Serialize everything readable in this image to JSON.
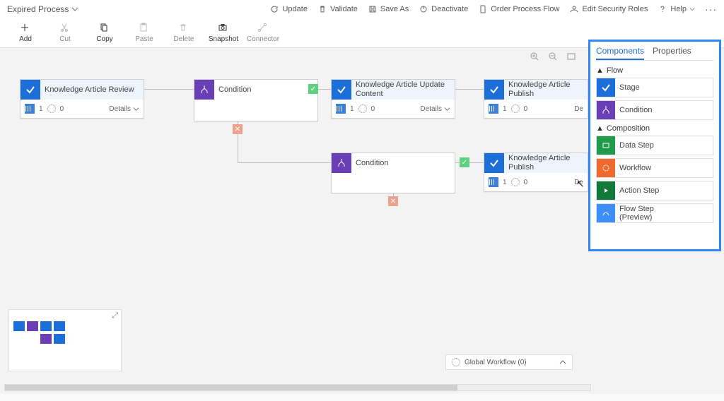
{
  "header": {
    "title": "Expired Process",
    "actions": [
      "Update",
      "Validate",
      "Save As",
      "Deactivate",
      "Order Process Flow",
      "Edit Security Roles",
      "Help"
    ]
  },
  "ribbon": {
    "items": [
      "Add",
      "Cut",
      "Copy",
      "Paste",
      "Delete",
      "Snapshot",
      "Connector"
    ]
  },
  "nodes": {
    "stage1": {
      "title": "Knowledge Article Review",
      "count": "1",
      "sub": "0",
      "details": "Details"
    },
    "cond1": {
      "title": "Condition"
    },
    "stage2": {
      "title": "Knowledge Article Update Content",
      "count": "1",
      "sub": "0",
      "details": "Details"
    },
    "stage3": {
      "title": "Knowledge Article Publish",
      "count": "1",
      "sub": "0",
      "details": "De"
    },
    "cond2": {
      "title": "Condition"
    },
    "stage4": {
      "title": "Knowledge Article Publish",
      "count": "1",
      "sub": "0",
      "details": "De"
    }
  },
  "panel": {
    "tabs": {
      "components": "Components",
      "properties": "Properties"
    },
    "group_flow": "Flow",
    "group_comp": "Composition",
    "items": {
      "stage": "Stage",
      "condition": "Condition",
      "datastep": "Data Step",
      "workflow": "Workflow",
      "actionstep": "Action Step",
      "flowstep": "Flow Step\n(Preview)"
    }
  },
  "footer": {
    "globalwf": "Global Workflow (0)"
  }
}
